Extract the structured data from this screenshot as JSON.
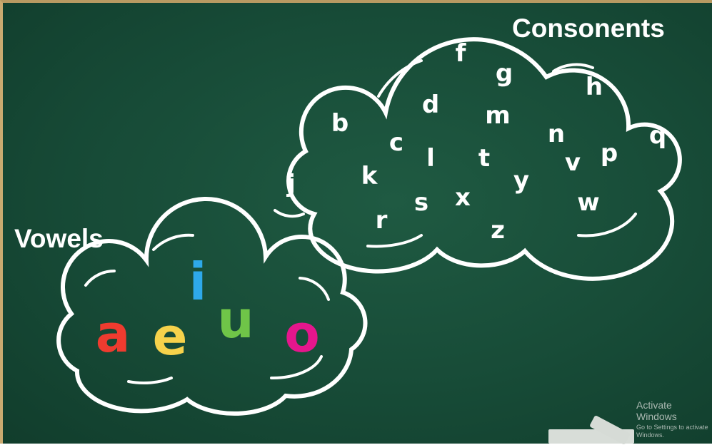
{
  "consonants_title": "Consonents",
  "vowels_title": "Vowels",
  "consonants": [
    "f",
    "g",
    "h",
    "d",
    "m",
    "b",
    "q",
    "n",
    "c",
    "v",
    "p",
    "l",
    "t",
    "y",
    "k",
    "j",
    "x",
    "s",
    "w",
    "r",
    "z"
  ],
  "vowels": [
    {
      "letter": "a",
      "color": "#ef3b2f"
    },
    {
      "letter": "e",
      "color": "#f6d24b"
    },
    {
      "letter": "i",
      "color": "#2ea9ea"
    },
    {
      "letter": "u",
      "color": "#6fc548"
    },
    {
      "letter": "o",
      "color": "#e5168c"
    }
  ],
  "watermark": {
    "line1": "Activate Windows",
    "line2": "Go to Settings to activate Windows."
  }
}
